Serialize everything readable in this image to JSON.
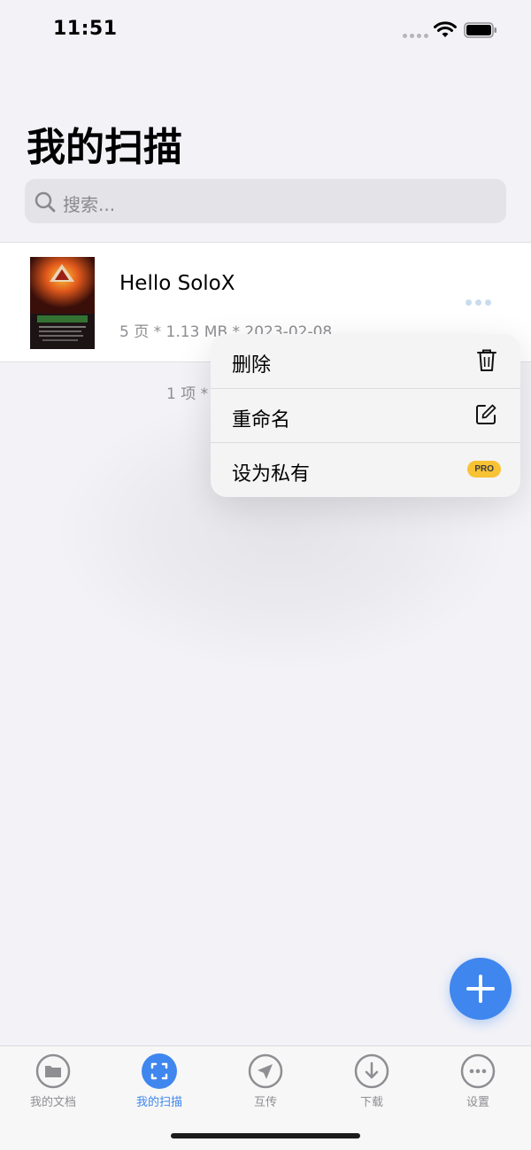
{
  "status_bar": {
    "time": "11:51"
  },
  "header": {
    "title": "我的扫描"
  },
  "search": {
    "placeholder": "搜索..."
  },
  "documents": [
    {
      "title": "Hello SoloX",
      "meta": "5 页 * 1.13 MB * 2023-02-08"
    }
  ],
  "footer": {
    "count": "1 项 *"
  },
  "context_menu": {
    "items": [
      {
        "label": "删除",
        "icon": "trash-icon"
      },
      {
        "label": "重命名",
        "icon": "edit-icon"
      },
      {
        "label": "设为私有",
        "badge": "PRO"
      }
    ]
  },
  "tab_bar": {
    "tabs": [
      {
        "label": "我的文档",
        "icon": "folder-icon",
        "active": false
      },
      {
        "label": "我的扫描",
        "icon": "scan-icon",
        "active": true
      },
      {
        "label": "互传",
        "icon": "send-icon",
        "active": false
      },
      {
        "label": "下载",
        "icon": "download-icon",
        "active": false
      },
      {
        "label": "设置",
        "icon": "more-circle-icon",
        "active": false
      }
    ]
  },
  "colors": {
    "accent": "#3f86ee",
    "badge": "#f7c234",
    "inactive": "#8e8e93"
  }
}
